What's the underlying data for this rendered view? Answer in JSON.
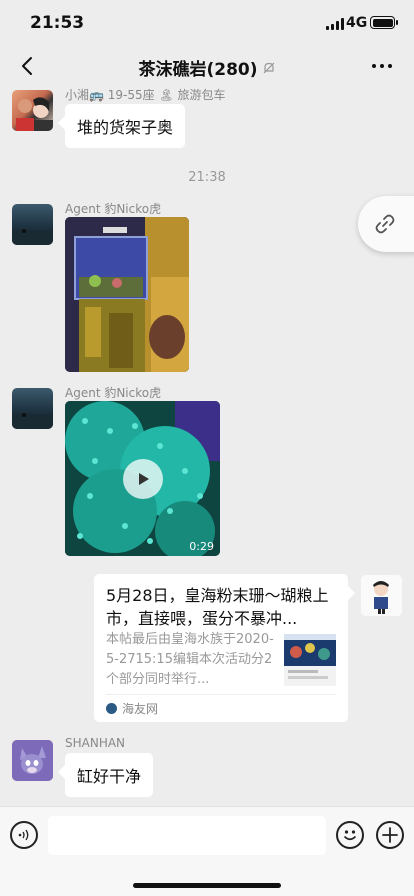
{
  "status": {
    "time": "21:53",
    "network": "4G"
  },
  "nav": {
    "title": "茶沫礁岩(280)"
  },
  "messages": {
    "m1": {
      "sender": "小湘🚌 19-55座 🏝 旅游包车",
      "text": "堆的货架子奥"
    },
    "timestamp": "21:38",
    "m2": {
      "sender": "Agent 豹Nicko虎"
    },
    "m3": {
      "sender": "Agent 豹Nicko虎",
      "duration": "0:29"
    },
    "link_card": {
      "title": "5月28日，皇海粉末珊～瑚粮上市，直接喂，蛋分不暴冲...",
      "desc": "本帖最后由皇海水族于2020-5-2715:15编辑本次活动分2个部分同时举行...",
      "source": "海友网"
    },
    "m4": {
      "sender": "SHANHAN",
      "text": "缸好干净"
    }
  },
  "icons": {
    "back": "chevron-left-icon",
    "mute": "bell-slash-icon",
    "more": "more-dots-icon",
    "link": "link-icon",
    "voice": "voice-icon",
    "emoji": "emoji-icon",
    "plus": "plus-icon"
  },
  "colors": {
    "background": "#ededed",
    "bubble": "#ffffff"
  }
}
